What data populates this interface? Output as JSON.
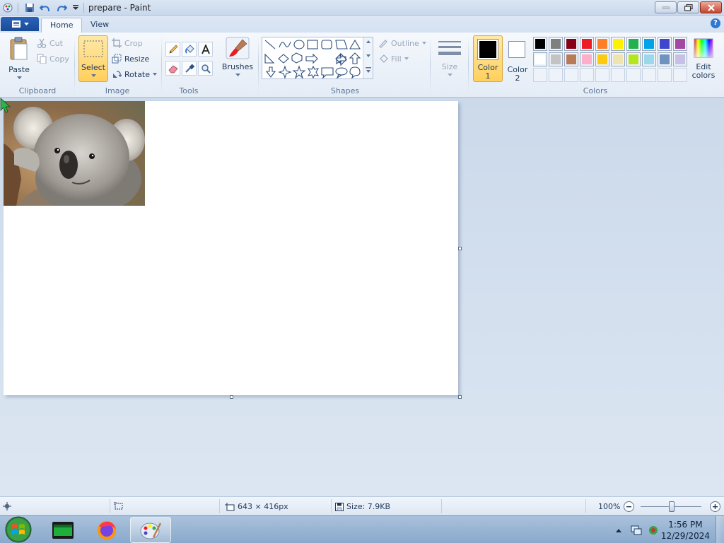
{
  "window": {
    "title": "prepare - Paint"
  },
  "tabs": {
    "home": "Home",
    "view": "View"
  },
  "clipboard": {
    "paste": "Paste",
    "cut": "Cut",
    "copy": "Copy",
    "group": "Clipboard"
  },
  "image": {
    "select": "Select",
    "crop": "Crop",
    "resize": "Resize",
    "rotate": "Rotate",
    "group": "Image"
  },
  "tools": {
    "group": "Tools"
  },
  "brushes": {
    "label": "Brushes"
  },
  "shapes": {
    "outline": "Outline",
    "fill": "Fill",
    "group": "Shapes"
  },
  "size": {
    "label": "Size"
  },
  "colors": {
    "color1_a": "Color",
    "color1_b": "1",
    "color2_a": "Color",
    "color2_b": "2",
    "edit_a": "Edit",
    "edit_b": "colors",
    "group": "Colors",
    "color1_value": "#000000",
    "color2_value": "#ffffff",
    "palette_row1": [
      "#000000",
      "#7f7f7f",
      "#880015",
      "#ed1c24",
      "#ff7f27",
      "#fff200",
      "#22b14c",
      "#00a2e8",
      "#3f48cc",
      "#a349a4"
    ],
    "palette_row2": [
      "#ffffff",
      "#c3c3c3",
      "#b97a57",
      "#ffaec9",
      "#ffc90e",
      "#efe4b0",
      "#b5e61d",
      "#99d9ea",
      "#7092be",
      "#c8bfe7"
    ]
  },
  "status": {
    "dimensions": "643 × 416px",
    "size": "Size: 7.9KB",
    "zoom": "100%"
  },
  "taskbar": {
    "time": "1:56 PM",
    "date": "12/29/2024"
  }
}
